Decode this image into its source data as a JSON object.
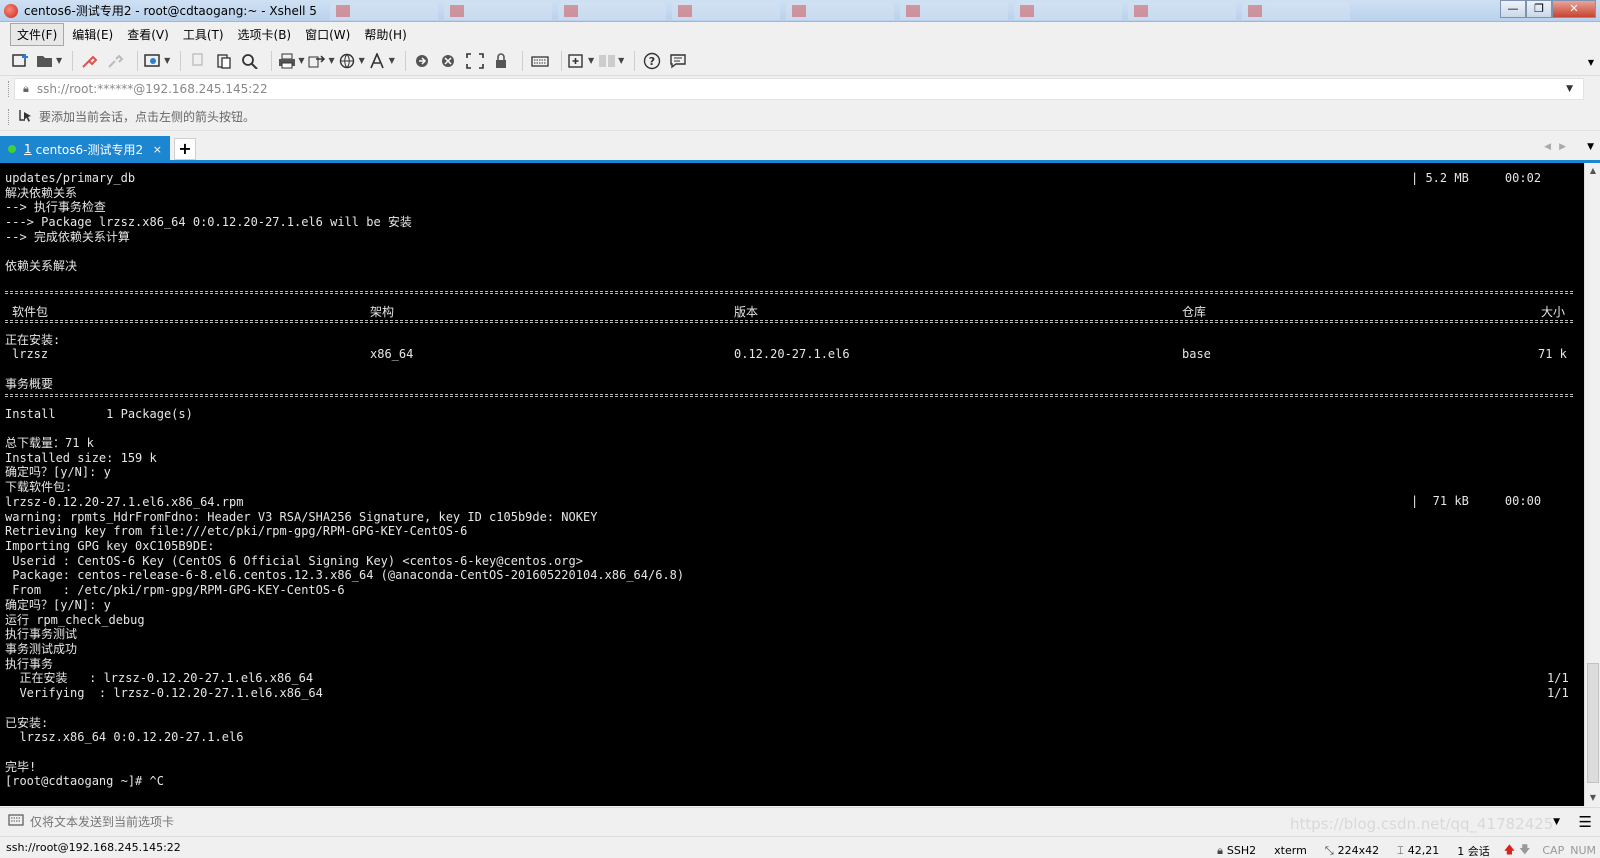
{
  "window": {
    "title": "centos6-测试专用2 - root@cdtaogang:~ - Xshell 5",
    "minimize": "—",
    "maximize": "❐",
    "close": "✕"
  },
  "menu": [
    "文件(F)",
    "编辑(E)",
    "查看(V)",
    "工具(T)",
    "选项卡(B)",
    "窗口(W)",
    "帮助(H)"
  ],
  "address": {
    "value": "ssh://root:******@192.168.245.145:22"
  },
  "hint": {
    "text": "要添加当前会话，点击左侧的箭头按钮。"
  },
  "tab": {
    "number": "1",
    "name": "centos6-测试专用2",
    "close": "×",
    "add": "+"
  },
  "terminal": {
    "lines": [
      "updates/primary_db",
      "解决依赖关系",
      "--> 执行事务检查",
      "---> Package lrzsz.x86_64 0:0.12.20-27.1.el6 will be 安装",
      "--> 完成依赖关系计算",
      "",
      "依赖关系解决",
      "",
      "",
      "",
      "",
      "正在安装:",
      "",
      "",
      "事务概要",
      "",
      "Install       1 Package(s)",
      "",
      "总下载量：71 k",
      "Installed size: 159 k",
      "确定吗？[y/N]: y",
      "下载软件包:",
      "lrzsz-0.12.20-27.1.el6.x86_64.rpm",
      "warning: rpmts_HdrFromFdno: Header V3 RSA/SHA256 Signature, key ID c105b9de: NOKEY",
      "Retrieving key from file:///etc/pki/rpm-gpg/RPM-GPG-KEY-CentOS-6",
      "Importing GPG key 0xC105B9DE:",
      " Userid : CentOS-6 Key (CentOS 6 Official Signing Key) <centos-6-key@centos.org>",
      " Package: centos-release-6-8.el6.centos.12.3.x86_64 (@anaconda-CentOS-201605220104.x86_64/6.8)",
      " From   : /etc/pki/rpm-gpg/RPM-GPG-KEY-CentOS-6",
      "确定吗？[y/N]: y",
      "运行 rpm_check_debug",
      "执行事务测试",
      "事务测试成功",
      "执行事务",
      "  正在安装   : lrzsz-0.12.20-27.1.el6.x86_64",
      "  Verifying  : lrzsz-0.12.20-27.1.el6.x86_64",
      "",
      "已安装:",
      "  lrzsz.x86_64 0:0.12.20-27.1.el6",
      "",
      "完毕!",
      "[root@cdtaogang ~]# ^C"
    ],
    "right": {
      "primary_db": "| 5.2 MB     00:02",
      "rpm_dl": "|  71 kB     00:00",
      "install_progress": "1/1",
      "verify_progress": "1/1"
    },
    "table": {
      "headers": [
        "软件包",
        "架构",
        "版本",
        "仓库",
        "大小"
      ],
      "row": [
        "lrzsz",
        "x86_64",
        "0.12.20-27.1.el6",
        "base",
        "71 k"
      ]
    }
  },
  "compose": {
    "placeholder": "仅将文本发送到当前选项卡"
  },
  "status": {
    "connection": "ssh://root@192.168.245.145:22",
    "protocol": "SSH2",
    "terminal": "xterm",
    "size": "224x42",
    "cursor": "42,21",
    "sessions": "1 会话",
    "caps": "CAP",
    "num": "NUM"
  },
  "watermark": "https://blog.csdn.net/qq_41782425"
}
